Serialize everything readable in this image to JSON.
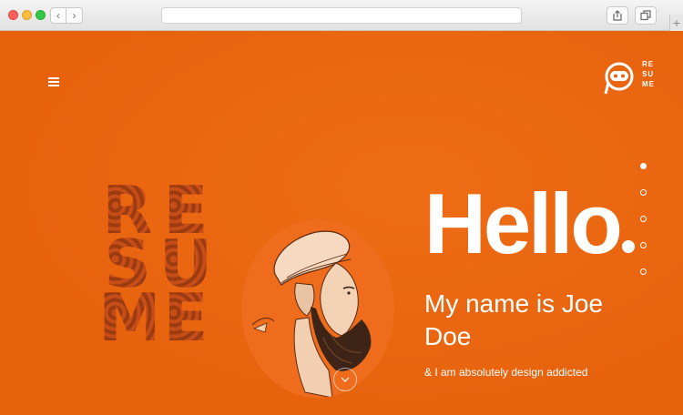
{
  "browser": {
    "back_glyph": "‹",
    "forward_glyph": "›",
    "newtab_glyph": "+",
    "icons": [
      "chevron-left-icon",
      "chevron-right-icon",
      "share-icon",
      "tabs-icon",
      "plus-icon"
    ]
  },
  "site": {
    "logo_text": [
      "RE",
      "SU",
      "ME"
    ],
    "hero_letters": [
      [
        "R",
        "E"
      ],
      [
        "S",
        "U"
      ],
      [
        "M",
        "E"
      ]
    ],
    "hello": "Hello",
    "name": "My name is Joe Doe",
    "tagline": "& I am absolutely design addicted",
    "nav_dots": 5,
    "active_dot": 1,
    "colors": {
      "background": "#e8620e",
      "text": "#ffffff",
      "accent_dark": "#b64512"
    },
    "icons": [
      "menu-icon",
      "logo-icon",
      "chevron-down-icon"
    ]
  }
}
